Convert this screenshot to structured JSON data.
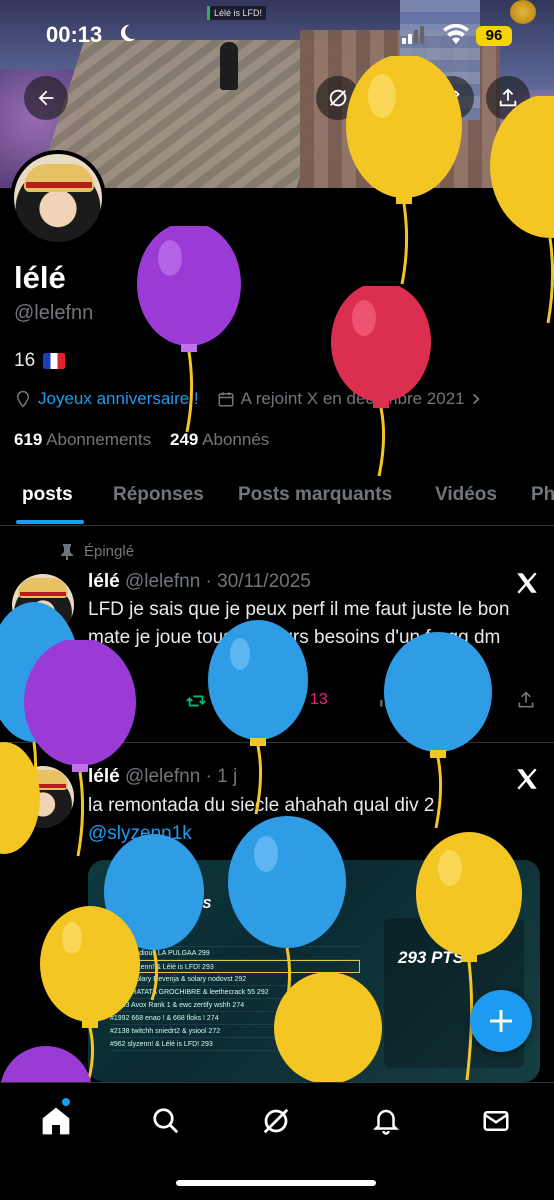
{
  "status_bar": {
    "time": "00:13",
    "battery": "96"
  },
  "banner": {
    "hud_text": "Lélé is LFD!"
  },
  "profile": {
    "name": "lélé",
    "handle": "@lelefnn",
    "bio": "16",
    "link_text": "Joyeux anniversaire !",
    "joined": "A rejoint X en décembre 2021",
    "following_count": "619",
    "following_label": "Abonnements",
    "followers_count": "249",
    "followers_label": "Abonnés"
  },
  "tabs": [
    {
      "label": "posts"
    },
    {
      "label": "Réponses"
    },
    {
      "label": "Posts marquants"
    },
    {
      "label": "Vidéos"
    },
    {
      "label": "Ph"
    }
  ],
  "posts": [
    {
      "pinned_label": "Épinglé",
      "author": "lélé",
      "handle": "@lelefnn",
      "separator": "·",
      "date": "30/11/2025",
      "text": "LFD je sais que je peux perf il me faut juste le bon mate je joue tous les jours besoins d'un fragg dm",
      "replies": "9",
      "reposts": "2",
      "likes": "13",
      "views": "2,6k"
    },
    {
      "author": "lélé",
      "handle": "@lelefnn",
      "separator": "·",
      "date": "1 j",
      "text": "la remontada du siecle ahahah qual div 2",
      "mention": "@slyzenn1k",
      "media": {
        "title": "Points du tournoi",
        "event": "ÉPREUVE FNCS",
        "score": "293 PTS",
        "rows": [
          "#736  ...  Nayrox fvl  300",
          "#789  ...  0dious LA PULGAA  299",
          "#962  slyzenn! & Lélé is LFD!  293",
          "#1000  Solary Revenja & solary nodovst  292",
          "#1032  RATATA GROCHIBRE & leethecrack 55  292",
          "#1983  Avox Rank 1 & ewc zertify wshh  274",
          "#1992  668 enao ! & 668 floks !  274",
          "#2138  twitchh sniedrt2 & ysiool  272",
          "#962  slyzenn! & Lélé is LFD!  293"
        ]
      }
    }
  ],
  "nav": [
    "home",
    "search",
    "grok",
    "notifications",
    "messages"
  ],
  "colors": {
    "accent": "#1d9bf0",
    "like": "#f91880",
    "repost": "#00ba7c",
    "battery": "#f6d400"
  }
}
